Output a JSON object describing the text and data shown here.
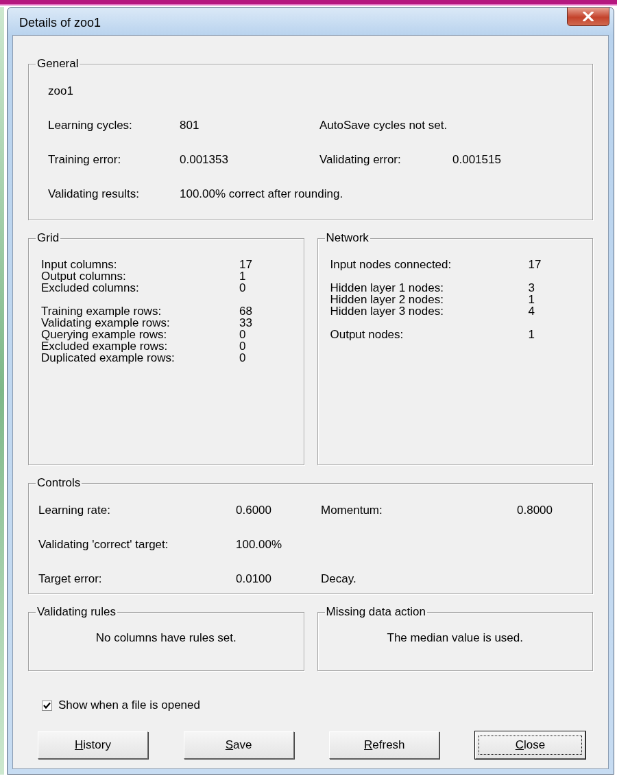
{
  "window": {
    "title": "Details of zoo1"
  },
  "general": {
    "title": "General",
    "name": "zoo1",
    "rows": [
      [
        {
          "label": "Learning cycles:",
          "value": "801"
        },
        {
          "text": "AutoSave cycles not set."
        }
      ],
      [
        {
          "label": "Training error:",
          "value": "0.001353"
        },
        {
          "label": "Validating error:",
          "value": "0.001515"
        }
      ],
      [
        {
          "label": "Validating results:",
          "value": "100.00% correct after rounding."
        }
      ]
    ]
  },
  "grid": {
    "title": "Grid",
    "sections": [
      [
        {
          "label": "Input columns:",
          "value": "17"
        },
        {
          "label": "Output columns:",
          "value": "1"
        },
        {
          "label": "Excluded columns:",
          "value": "0"
        }
      ],
      [
        {
          "label": "Training example rows:",
          "value": "68"
        },
        {
          "label": "Validating example rows:",
          "value": "33"
        },
        {
          "label": "Querying example rows:",
          "value": "0"
        },
        {
          "label": "Excluded example rows:",
          "value": "0"
        },
        {
          "label": "Duplicated example rows:",
          "value": "0"
        }
      ]
    ]
  },
  "network": {
    "title": "Network",
    "sections": [
      [
        {
          "label": "Input nodes connected:",
          "value": "17"
        }
      ],
      [
        {
          "label": "Hidden layer 1 nodes:",
          "value": "3"
        },
        {
          "label": "Hidden layer 2 nodes:",
          "value": "1"
        },
        {
          "label": "Hidden layer 3 nodes:",
          "value": "4"
        }
      ],
      [
        {
          "label": "Output nodes:",
          "value": "1"
        }
      ]
    ]
  },
  "controls": {
    "title": "Controls",
    "rows": [
      [
        {
          "label": "Learning rate:",
          "value": "0.6000"
        },
        {
          "label": "Momentum:",
          "value": "0.8000"
        }
      ],
      [
        {
          "label": "Validating 'correct' target:",
          "value": "100.00%"
        }
      ],
      [
        {
          "label": "Target error:",
          "value": "0.0100"
        },
        {
          "text": "Decay."
        }
      ]
    ]
  },
  "validating_rules": {
    "title": "Validating rules",
    "text": "No columns have rules set."
  },
  "missing_data_action": {
    "title": "Missing data action",
    "text": "The median value is used."
  },
  "show_on_open": {
    "label": "Show when a file is opened",
    "checked": true
  },
  "buttons": [
    {
      "label": "History",
      "default": false
    },
    {
      "label": "Save",
      "default": false
    },
    {
      "label": "Refresh",
      "default": false
    },
    {
      "label": "Close",
      "default": true
    }
  ]
}
